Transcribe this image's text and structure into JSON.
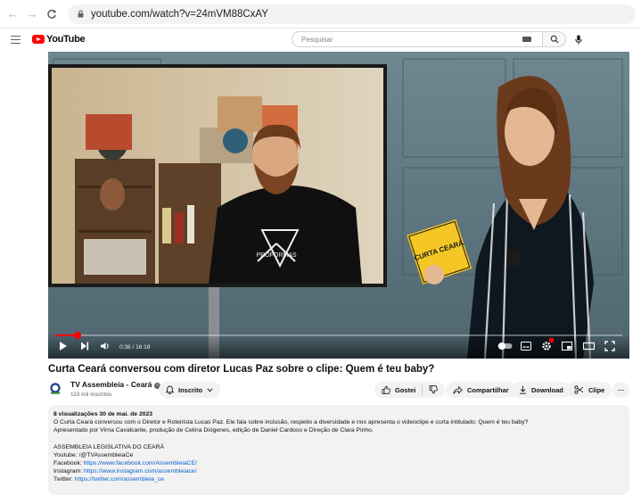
{
  "browser": {
    "url": "youtube.com/watch?v=24mVM88CxAY"
  },
  "header": {
    "logo_text": "YouTube",
    "search_placeholder": "Pesquisar"
  },
  "player": {
    "time": "0:38 / 16:18",
    "progress": 0.039,
    "prop_card_text": "CURTA CEARÁ",
    "shirt_text": "PROFORMAS"
  },
  "video": {
    "title": "Curta Ceará conversou com diretor Lucas Paz sobre o clipe: Quem é teu baby?"
  },
  "channel": {
    "name": "TV Assembleia - Ceará",
    "subscribers": "110 mil inscritos",
    "subscribe_label": "Inscrito"
  },
  "actions": {
    "like_label": "Gostei",
    "share_label": "Compartilhar",
    "download_label": "Download",
    "clip_label": "Clipe",
    "more_label": "···"
  },
  "description": {
    "meta": "8 visualizações  30 de mai. de 2023",
    "lines": [
      "O Curta Ceará conversou com o Diretor e Roteirista Lucas Paz. Ele fala sobre inclusão, respeito a diversidade e nos apresenta o videoclipe e curta intitulado: Quem é teu baby?",
      "Apresentado por Virna Cavalcante, produção de Celina Diógenes, edição de Daniel Cardoso e Direção de Clara Pinho."
    ],
    "org": "ASSEMBLEIA LEGISLATIVA DO CEARÁ",
    "links": [
      {
        "label": "Youtube: ",
        "value": "/@TVAssembleiaCe"
      },
      {
        "label": "Facebook: ",
        "value": "https://www.facebook.com/AssembleiaCE/"
      },
      {
        "label": "Instagram: ",
        "value": "https://www.instagram.com/assembleiace/"
      },
      {
        "label": "Twitter: ",
        "value": "https://twitter.com/assembleia_ce"
      }
    ]
  },
  "colors": {
    "brand_red": "#ff0000",
    "link_blue": "#065fd4",
    "pill_bg": "#f2f2f2"
  }
}
